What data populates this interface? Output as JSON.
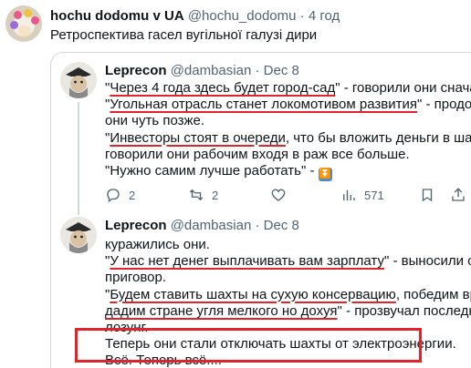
{
  "outer_tweet": {
    "display_name": "hochu dodomu v UA",
    "handle": "@hochu_dodomu",
    "separator": "·",
    "time": "4 год",
    "text": "Ретроспектива  гасел вугільної галузі дири"
  },
  "quoted_tweets": [
    {
      "display_name": "Leprecon",
      "handle": "@dambasian",
      "separator": "·",
      "date": "Dec 8",
      "lines": [
        {
          "pre": "\"",
          "ul": "Через 4 года здесь будет город-сад",
          "post": "\" - говорили они сначала."
        },
        {
          "pre": "\"",
          "ul": "Угольная отрасль станет локомотивом развития",
          "post": "\" - продолжали"
        },
        {
          "pre": "",
          "ul": "",
          "post": "они чуть позже."
        },
        {
          "pre": "\"",
          "ul": "Инвесторы стоят в очереди",
          "post": ", что бы вложить деньги в шахты\" -"
        },
        {
          "pre": "",
          "ul": "",
          "post": "говорили они рабочим входя в раж все больше."
        },
        {
          "pre": "",
          "ul": "",
          "post": "\"Нужно самим лучше работать\" - "
        }
      ],
      "emoji_icon": "down-arrow-button-emoji",
      "actions": {
        "replies": "2",
        "reposts": "2",
        "likes": "",
        "views": "571"
      }
    },
    {
      "display_name": "Leprecon",
      "handle": "@dambasian",
      "separator": "·",
      "date": "Dec 8",
      "lines": [
        {
          "pre": "",
          "ul": "",
          "post": "куражились они."
        },
        {
          "pre": "\"",
          "ul": "У нас нет денег выплачивать вам зарплату",
          "post": "\" - выносили они"
        },
        {
          "pre": "",
          "ul": "",
          "post": "приговор."
        },
        {
          "pre": "\"",
          "ul": "Будем ставить шахты на сухую консервацию",
          "post": ", победим врага и"
        },
        {
          "pre": "",
          "ul": "дадим стране угля мелкого но дохуя",
          "post": "\" - прозвучал последний"
        },
        {
          "pre": "",
          "ul": "",
          "post": "лозунг."
        },
        {
          "pre": "",
          "ul": "",
          "post": "Теперь они стали отключать шахты от электроэнергии."
        },
        {
          "pre": "",
          "ul": "",
          "post": "Всё. Теперь всё...."
        }
      ]
    }
  ],
  "colors": {
    "underline_red": "#e0242b",
    "text": "#0f1419",
    "secondary": "#536471",
    "border": "#cfd9de"
  }
}
